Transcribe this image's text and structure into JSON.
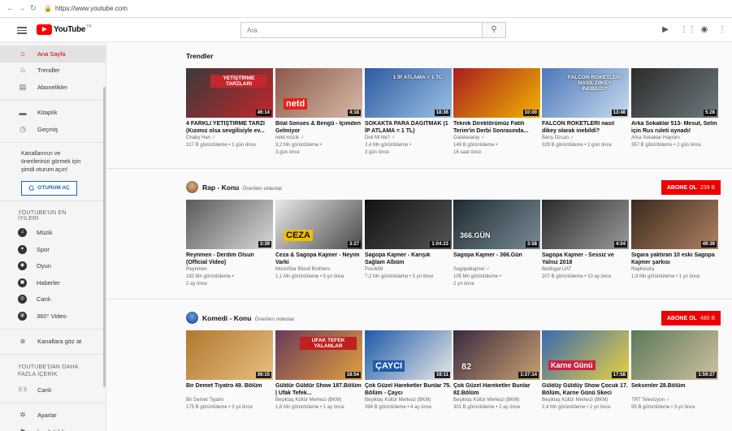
{
  "browser": {
    "url": "https://www.youtube.com"
  },
  "masthead": {
    "logo_text": "YouTube",
    "logo_tr": "TR",
    "search_placeholder": "Ara"
  },
  "sidebar": {
    "main_items": [
      {
        "label": "Ana Sayfa",
        "icon": "home-icon",
        "glyph": "⌂",
        "active": true
      },
      {
        "label": "Trendler",
        "icon": "trending-icon",
        "glyph": "♨",
        "active": false
      },
      {
        "label": "Abonelikler",
        "icon": "subscriptions-icon",
        "glyph": "▤",
        "active": false
      }
    ],
    "library_items": [
      {
        "label": "Kitaplık",
        "icon": "library-icon",
        "glyph": "▬"
      },
      {
        "label": "Geçmiş",
        "icon": "history-icon",
        "glyph": "◷"
      }
    ],
    "promo_text": "Kanallarınızı ve önerilerinizi görmek için şimdi oturum açın!",
    "sign_in_label": "OTURUM AÇ",
    "best_heading": "YOUTUBE'UN EN İYİLERİ",
    "best_items": [
      {
        "label": "Müzik",
        "icon": "music-icon",
        "glyph": "♫"
      },
      {
        "label": "Spor",
        "icon": "sports-icon",
        "glyph": "✦"
      },
      {
        "label": "Oyun",
        "icon": "gaming-icon",
        "glyph": "◉"
      },
      {
        "label": "Haberler",
        "icon": "news-icon",
        "glyph": "▣"
      },
      {
        "label": "Canlı",
        "icon": "live-icon",
        "glyph": "◎"
      },
      {
        "label": "360° Video",
        "icon": "video-360-icon",
        "glyph": "◍"
      }
    ],
    "browse_label": "Kanallara göz at",
    "more_heading": "YOUTUBE'DAN DAHA FAZLA İÇERİK",
    "more_items": [
      {
        "label": "Canlı",
        "icon": "live-broadcast-icon",
        "glyph": "((·))"
      }
    ],
    "bottom_items": [
      {
        "label": "Ayarlar",
        "icon": "settings-icon",
        "glyph": "✲"
      },
      {
        "label": "İçerik bildirme ge...",
        "icon": "flag-icon",
        "glyph": "⚑"
      }
    ]
  },
  "sections": [
    {
      "title": "Trendler",
      "subtitle": "",
      "subscribe": null,
      "videos": [
        {
          "title": "4 FARKLI YETİŞTİRME TARZI (Kızımız olsa sevgilisiyle ev...",
          "channel": "Chaby Han",
          "verified": true,
          "meta": "317 B görüntüleme • 1 gün önce",
          "duration": "46:14",
          "colors": [
            "#3a3a3a",
            "#c1272d"
          ],
          "overlay": "YETİŞTİRME TARZLARI",
          "overlay_color": "#ffffff",
          "overlay_bg": "#c1272d"
        },
        {
          "title": "Bilal Sonses & Bengü - İçimden Gelmiyor",
          "channel": "netd müzik",
          "verified": true,
          "meta": "3,2 Mn görüntüleme •",
          "meta2": "3 gün önce",
          "duration": "4:18",
          "colors": [
            "#8b5a4a",
            "#d8b9a8"
          ],
          "overlay": "netd",
          "overlay_color": "#ffffff",
          "overlay_bg": "#e2231a"
        },
        {
          "title": "SOKAKTA PARA DAĞITMAK (1 İP ATLAMA = 1 TL)",
          "channel": "Deli Mi Ne?",
          "verified": true,
          "meta": "2,4 Mn görüntüleme •",
          "meta2": "3 gün önce",
          "duration": "18:36",
          "colors": [
            "#2d5aa0",
            "#9bc1e6"
          ],
          "overlay": "1 İP ATLAMA = 1 TL",
          "overlay_color": "#ffffff",
          "overlay_bg": "transparent"
        },
        {
          "title": "Teknik Direktörümüz Fatih Terim'in Derbi Sonrasında...",
          "channel": "Galatasaray",
          "verified": true,
          "meta": "148 B görüntüleme •",
          "meta2": "16 saat önce",
          "duration": "10:00",
          "colors": [
            "#a91d22",
            "#f0b400"
          ],
          "overlay": "",
          "overlay_color": "#ffffff",
          "overlay_bg": "transparent"
        },
        {
          "title": "FALCON ROKETLERİ nasıl dikey olarak inebildi?",
          "channel": "Barış Özcan",
          "verified": true,
          "meta": "329 B görüntüleme • 1 gün önce",
          "duration": "13:48",
          "colors": [
            "#4a78b8",
            "#c9dbf0"
          ],
          "overlay": "FALCON ROKETLERİ NASIL DİKEY İNEBİLDİ?",
          "overlay_color": "#ffffff",
          "overlay_bg": "transparent"
        },
        {
          "title": "Arka Sokaklar 513- Mesut, Selin için Rus ruleti oynadı!",
          "channel": "Arka Sokaklar Hayranı",
          "verified": false,
          "meta": "357 B görüntüleme • 2 gün önce",
          "duration": "5:28",
          "colors": [
            "#2b2b2b",
            "#6e7a80"
          ],
          "overlay": "",
          "overlay_color": "#ffffff",
          "overlay_bg": "transparent"
        }
      ]
    },
    {
      "title": "Rap - Konu",
      "subtitle": "Önerilen videolar",
      "subscribe": {
        "label": "ABONE OL",
        "count": "239 B"
      },
      "videos": [
        {
          "title": "Reynmen - Derdim Olsun (Official Video)",
          "channel": "Reynmen",
          "verified": false,
          "meta": "182 Mn görüntüleme •",
          "meta2": "2 ay önce",
          "duration": "3:39",
          "colors": [
            "#5a5a5a",
            "#d8d8d8"
          ],
          "overlay": "",
          "overlay_color": "#ffffff",
          "overlay_bg": "transparent"
        },
        {
          "title": "Ceza & Sagopa Kajmer - Neyim Varki",
          "channel": "MoonStar Blood Brothers",
          "verified": false,
          "meta": "1,1 Mn görüntüleme • 5 yıl önce",
          "duration": "3:27",
          "colors": [
            "#e8e8e8",
            "#4a4a4a"
          ],
          "overlay": "CEZA",
          "overlay_color": "#111111",
          "overlay_bg": "#f0c000"
        },
        {
          "title": "Sagopa Kajmer - Karışık Sağlam Albüm",
          "channel": "Psicik56",
          "verified": false,
          "meta": "7,2 Mn görüntüleme • 5 yıl önce",
          "duration": "1:04:23",
          "colors": [
            "#111111",
            "#555555"
          ],
          "overlay": "",
          "overlay_color": "#ffffff",
          "overlay_bg": "transparent"
        },
        {
          "title": "Sagopa Kajmer - 366.Gün",
          "channel": "Sagopakajmer",
          "verified": true,
          "meta": "105 Mn görüntüleme •",
          "meta2": "2 yıl önce",
          "duration": "3:58",
          "colors": [
            "#1e2a33",
            "#7a8c96"
          ],
          "overlay": "366.GÜN",
          "overlay_color": "#ffffff",
          "overlay_bg": "transparent"
        },
        {
          "title": "Sagopa Kajmer - Sessiz ve Yalnız 2018",
          "channel": "Bedisgal UAT",
          "verified": false,
          "meta": "207 B görüntüleme • 10 ay önce",
          "duration": "4:04",
          "colors": [
            "#2a2a2a",
            "#9a9a9a"
          ],
          "overlay": "",
          "overlay_color": "#ffffff",
          "overlay_bg": "transparent"
        },
        {
          "title": "Sigara yaktıran 10 eski Sagopa Kajmer şarkısı",
          "channel": "RapKestra",
          "verified": false,
          "meta": "1,9 Mn görüntüleme • 1 yıl önce",
          "duration": "49:39",
          "colors": [
            "#3a2a20",
            "#b08060"
          ],
          "overlay": "",
          "overlay_color": "#ffffff",
          "overlay_bg": "transparent"
        }
      ]
    },
    {
      "title": "Komedi - Konu",
      "subtitle": "Önerilen videolar",
      "subscribe": {
        "label": "ABONE OL",
        "count": "480 B"
      },
      "videos": [
        {
          "title": "Bir Demet Tiyatro 49. Bölüm",
          "channel": "Bir Demet Tiyatro",
          "verified": false,
          "meta": "175 B görüntüleme • 3 yıl önce",
          "duration": "36:15",
          "colors": [
            "#b07830",
            "#e8c080"
          ],
          "overlay": "",
          "overlay_color": "#ffffff",
          "overlay_bg": "transparent"
        },
        {
          "title": "Güldür Güldür Show 187.Bölüm | Ufak Tefek...",
          "channel": "Beşiktaş Kültür Merkezi (BKM)",
          "verified": false,
          "meta": "1,6 Mn görüntüleme • 1 ay önce",
          "duration": "18:54",
          "colors": [
            "#6a3a5a",
            "#e0a040"
          ],
          "overlay": "UFAK TEFEK YALANLAR",
          "overlay_color": "#ffffff",
          "overlay_bg": "#c02020"
        },
        {
          "title": "Çok Güzel Hareketler Bunlar 75. Bölüm - Çaycı",
          "channel": "Beşiktaş Kültür Merkezi (BKM)",
          "verified": false,
          "meta": "394 B görüntüleme • 4 ay önce",
          "duration": "16:11",
          "colors": [
            "#1f5aa8",
            "#e8e8e8"
          ],
          "overlay": "ÇAYCI",
          "overlay_color": "#ffffff",
          "overlay_bg": "#1f5aa8"
        },
        {
          "title": "Çok Güzel Hareketler Bunlar 82.Bölüm",
          "channel": "Beşiktaş Kültür Merkezi (BKM)",
          "verified": false,
          "meta": "301 B görüntüleme • 2 ay önce",
          "duration": "1:37:14",
          "colors": [
            "#3a2a40",
            "#c8a070"
          ],
          "overlay": "82",
          "overlay_color": "#ffffff",
          "overlay_bg": "transparent"
        },
        {
          "title": "Güldüy Güldüy Show Çocuk 17. Bölüm, Karne Günü Skeci",
          "channel": "Beşiktaş Kültür Merkezi (BKM)",
          "verified": false,
          "meta": "2,4 Mn görüntüleme • 2 yıl önce",
          "duration": "17:58",
          "colors": [
            "#3a6ab0",
            "#e8d040"
          ],
          "overlay": "Karne Günü",
          "overlay_color": "#ffffff",
          "overlay_bg": "#d02040"
        },
        {
          "title": "Seksenler 28.Bölüm",
          "channel": "TRT Televizyon",
          "verified": true,
          "meta": "95 B görüntüleme • 3 yıl önce",
          "duration": "1:59:27",
          "colors": [
            "#5a7a5a",
            "#d0c0a0"
          ],
          "overlay": "",
          "overlay_color": "#ffffff",
          "overlay_bg": "transparent"
        }
      ]
    }
  ]
}
